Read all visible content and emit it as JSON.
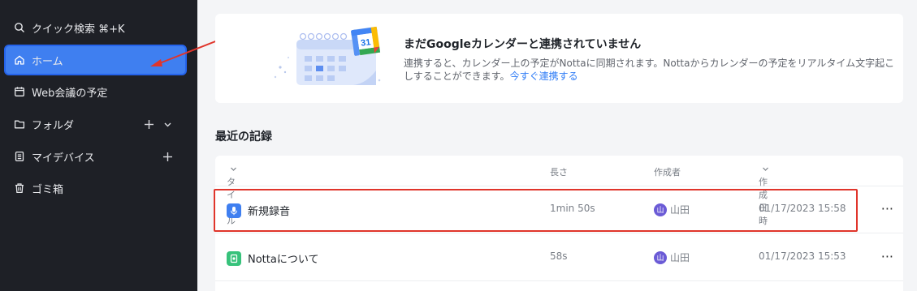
{
  "sidebar": {
    "items": [
      {
        "label": "クイック検索 ⌘+K",
        "icon": "search-icon"
      },
      {
        "label": "ホーム",
        "icon": "home-icon"
      },
      {
        "label": "Web会議の予定",
        "icon": "calendar-icon"
      },
      {
        "label": "フォルダ",
        "icon": "folder-icon"
      },
      {
        "label": "マイデバイス",
        "icon": "device-icon"
      },
      {
        "label": "ゴミ箱",
        "icon": "trash-icon"
      }
    ]
  },
  "banner": {
    "title": "まだGoogleカレンダーと連携されていません",
    "text": "連携すると、カレンダー上の予定がNottaに同期されます。Nottaからカレンダーの予定をリアルタイム文字起こしすることができます。",
    "link": "今すぐ連携する",
    "calendar_badge": "31"
  },
  "recent": {
    "title": "最近の記録",
    "columns": {
      "title": "タイトル",
      "length": "長さ",
      "creator": "作成者",
      "created": "作成日時"
    },
    "rows": [
      {
        "title": "新規録音",
        "length": "1min 50s",
        "avatar": "山",
        "creator": "山田",
        "created": "01/17/2023 15:58",
        "more": "···"
      },
      {
        "title": "Nottaについて",
        "length": "58s",
        "avatar": "山",
        "creator": "山田",
        "created": "01/17/2023 15:53",
        "more": "···"
      }
    ]
  },
  "colors": {
    "accent": "#3f7ff0",
    "sidebar_bg": "#1e2026",
    "highlight": "#e0352b",
    "avatar": "#6b5bd6"
  }
}
